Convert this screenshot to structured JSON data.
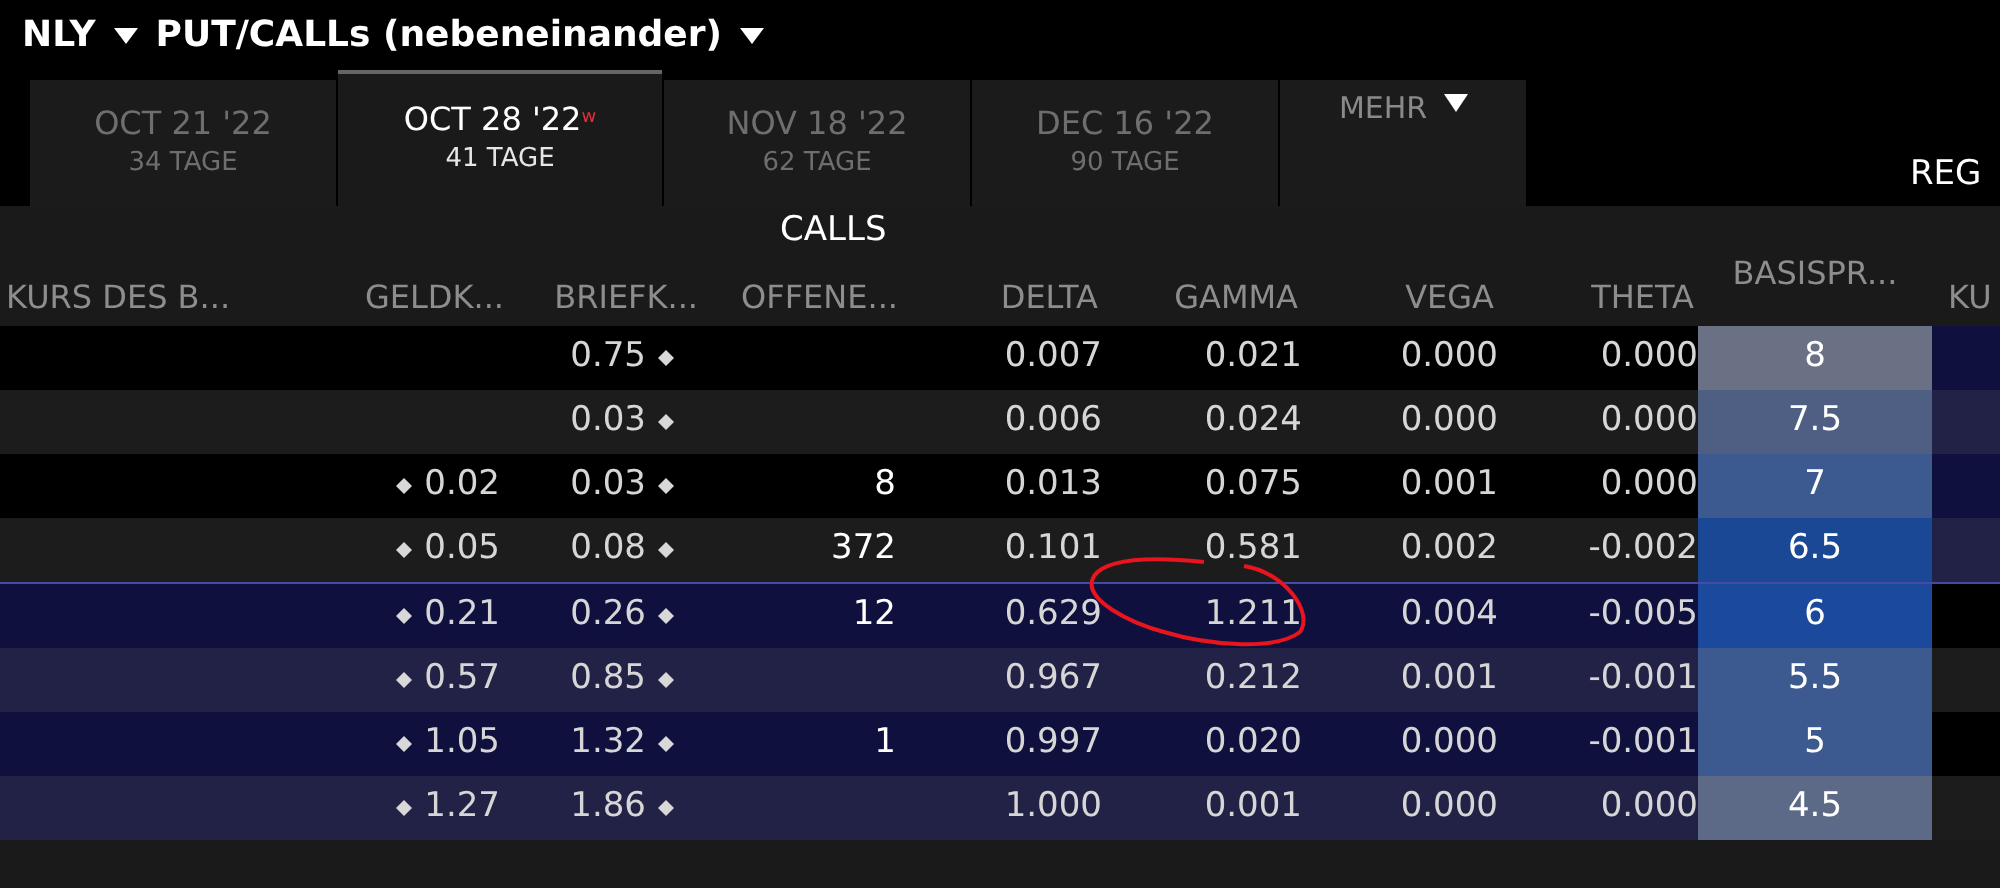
{
  "header": {
    "symbol": "NLY",
    "view": "PUT/CALLs (nebeneinander)"
  },
  "tabs": [
    {
      "date": "OCT 21 '22",
      "days": "34 TAGE",
      "selected": false
    },
    {
      "date": "OCT 28 '22",
      "superscript": "w",
      "days": "41 TAGE",
      "selected": true
    },
    {
      "date": "NOV 18 '22",
      "days": "62 TAGE",
      "selected": false
    },
    {
      "date": "DEC 16 '22",
      "days": "90 TAGE",
      "selected": false
    }
  ],
  "more_menu": "MEHR",
  "right_label": "REG",
  "calls_title": "CALLS",
  "columns": [
    "KURS DES B...",
    "GELDK...",
    "BRIEFK...",
    "OFFENE...",
    "DELTA",
    "GAMMA",
    "VEGA",
    "THETA"
  ],
  "strike_header": "BASISPR...",
  "puts_column_partial": "KU",
  "rows": [
    {
      "bid": "",
      "ask": "0.75",
      "open_interest": "",
      "delta": "0.007",
      "gamma": "0.021",
      "vega": "0.000",
      "theta": "0.000",
      "strike": "8",
      "color": "#6b7184",
      "in_the_money": false
    },
    {
      "bid": "",
      "ask": "0.03",
      "open_interest": "",
      "delta": "0.006",
      "gamma": "0.024",
      "vega": "0.000",
      "theta": "0.000",
      "strike": "7.5",
      "color": "#4f5f84",
      "in_the_money": false
    },
    {
      "bid": "0.02",
      "ask": "0.03",
      "open_interest": "8",
      "delta": "0.013",
      "gamma": "0.075",
      "vega": "0.001",
      "theta": "0.000",
      "strike": "7",
      "color": "#3c5a90",
      "in_the_money": false
    },
    {
      "bid": "0.05",
      "ask": "0.08",
      "open_interest": "372",
      "delta": "0.101",
      "gamma": "0.581",
      "vega": "0.002",
      "theta": "-0.002",
      "strike": "6.5",
      "color": "#1b4894",
      "in_the_money": false
    },
    {
      "bid": "0.21",
      "ask": "0.26",
      "open_interest": "12",
      "delta": "0.629",
      "gamma": "1.211",
      "vega": "0.004",
      "theta": "-0.005",
      "strike": "6",
      "color": "#1b4a9c",
      "in_the_money": true,
      "annotated": true
    },
    {
      "bid": "0.57",
      "ask": "0.85",
      "open_interest": "",
      "delta": "0.967",
      "gamma": "0.212",
      "vega": "0.001",
      "theta": "-0.001",
      "strike": "5.5",
      "color": "#3d5a90",
      "in_the_money": true
    },
    {
      "bid": "1.05",
      "ask": "1.32",
      "open_interest": "1",
      "delta": "0.997",
      "gamma": "0.020",
      "vega": "0.000",
      "theta": "-0.001",
      "strike": "5",
      "color": "#3c5a8f",
      "in_the_money": true
    },
    {
      "bid": "1.27",
      "ask": "1.86",
      "open_interest": "",
      "delta": "1.000",
      "gamma": "0.001",
      "vega": "0.000",
      "theta": "0.000",
      "strike": "4.5",
      "color": "#5d6a87",
      "in_the_money": true
    }
  ]
}
